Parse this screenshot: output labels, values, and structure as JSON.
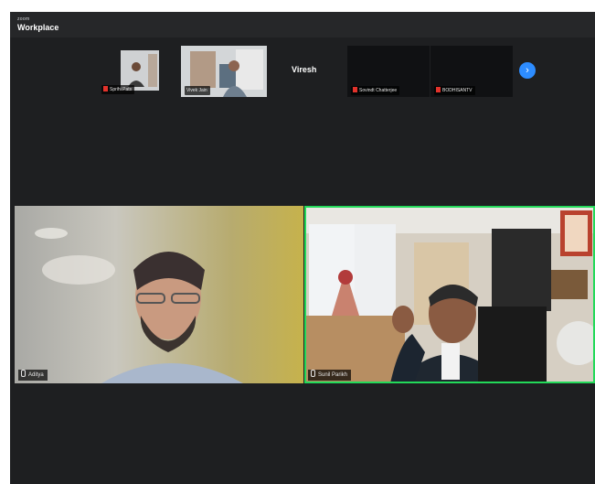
{
  "app": {
    "brand_small": "zoom",
    "brand": "Workplace"
  },
  "strip": {
    "tiles": [
      {
        "label": "Sprihi Pats",
        "muted": true
      },
      {
        "label": "Vivek Jain",
        "muted": false
      },
      {
        "label": "Viresh"
      },
      {
        "label": "Sovindt Chatterjee",
        "muted": true
      },
      {
        "label": "BODHISANTV",
        "muted": true
      }
    ]
  },
  "main": {
    "left_label": "Aditya",
    "right_label": "Sunil Parikh"
  },
  "colors": {
    "active_speaker": "#23d959",
    "accent": "#2d8cff",
    "muted": "#e2322b"
  }
}
